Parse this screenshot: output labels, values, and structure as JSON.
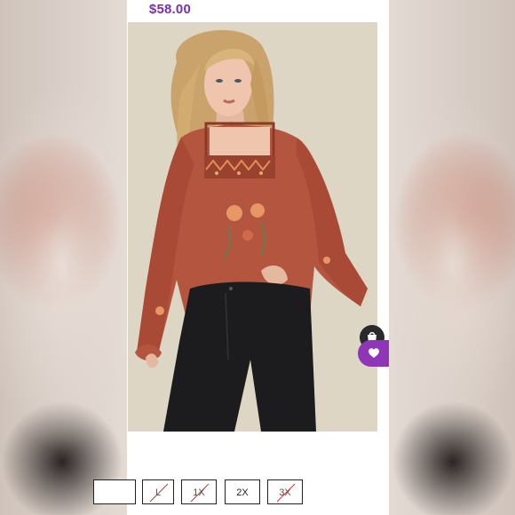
{
  "listing": {
    "price": "$58.00"
  },
  "photo": {
    "description_icon": "product-photo"
  },
  "actions": {
    "bag_icon": "shopping-bag-icon",
    "like_icon": "heart-icon"
  },
  "sizes": [
    {
      "label": "",
      "available": false
    },
    {
      "label": "L",
      "available": false
    },
    {
      "label": "1X",
      "available": false
    },
    {
      "label": "2X",
      "available": true
    },
    {
      "label": "3X",
      "available": false
    }
  ],
  "colors": {
    "price": "#7b2fa8",
    "like_button": "#8e35b8",
    "blouse": "#b4553f"
  }
}
